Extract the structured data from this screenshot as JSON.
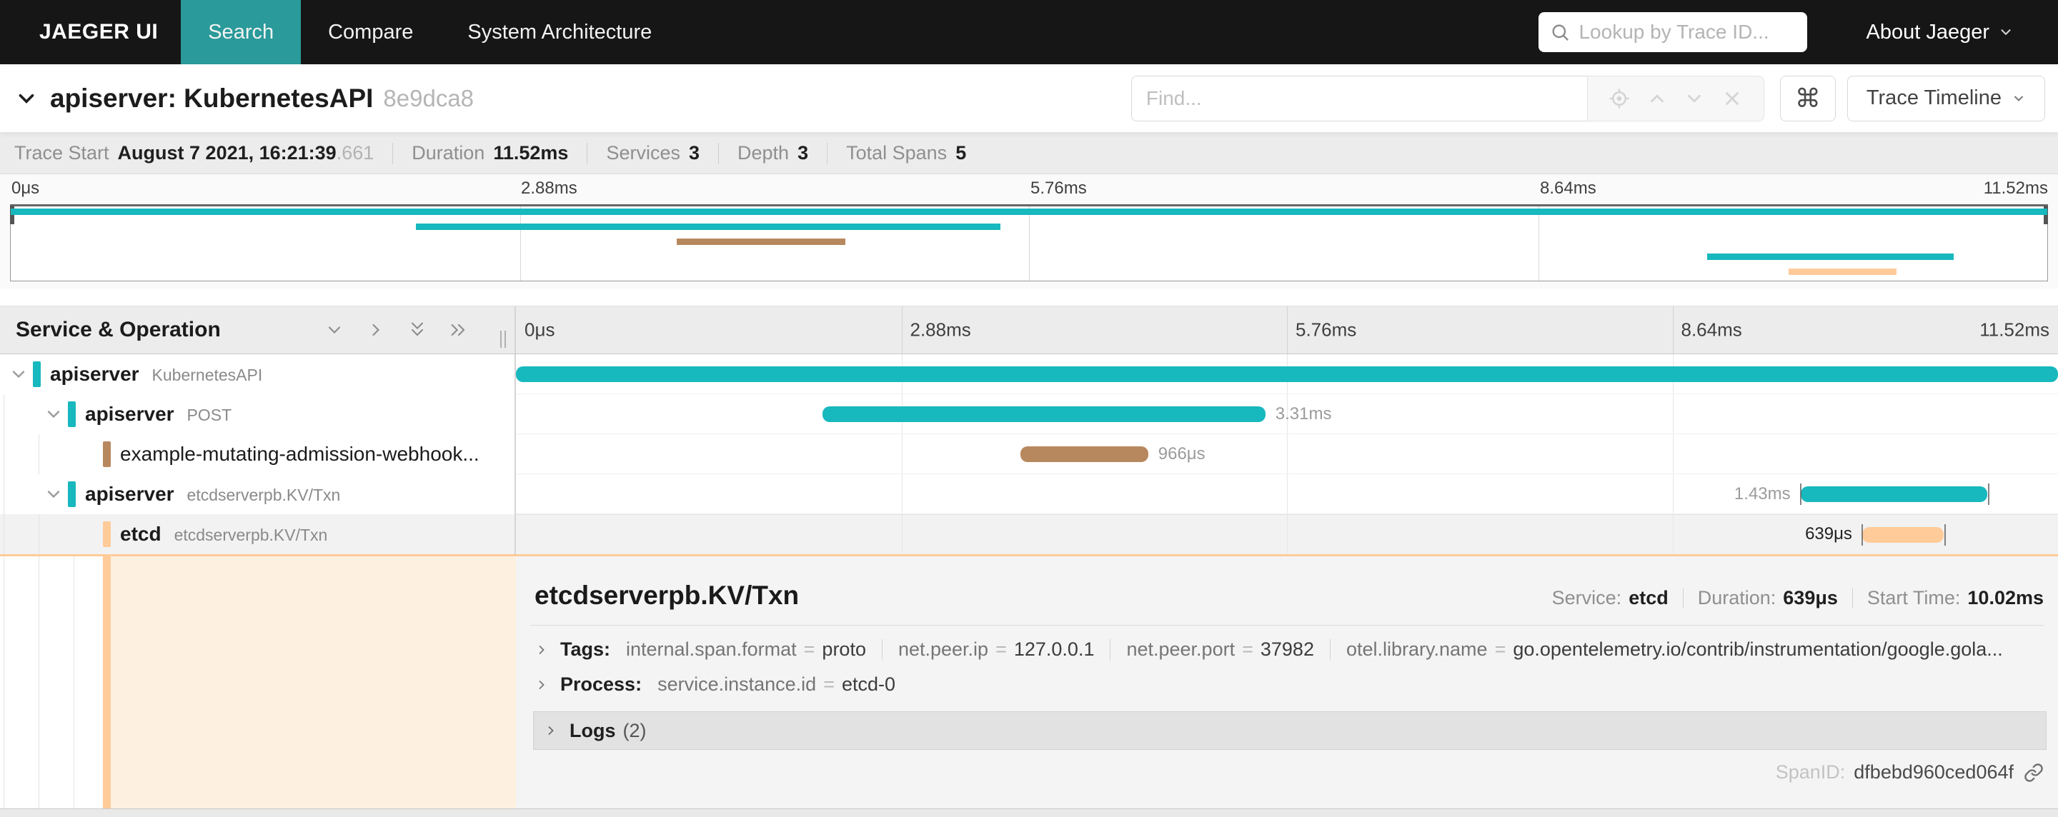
{
  "colors": {
    "nav_bg": "#161616",
    "nav_active": "#2a9a9a",
    "teal": "#17B8BE",
    "brown": "#B7885E",
    "peach": "#FFCB99",
    "selected_row_bg": "#f2f2f2",
    "panel_bg": "#f4f4f4"
  },
  "nav": {
    "brand": "JAEGER UI",
    "items": [
      {
        "label": "Search",
        "active": true
      },
      {
        "label": "Compare",
        "active": false
      },
      {
        "label": "System Architecture",
        "active": false
      }
    ],
    "lookup_placeholder": "Lookup by Trace ID...",
    "about_label": "About Jaeger"
  },
  "trace_header": {
    "title": "apiserver: KubernetesAPI",
    "trace_id": "8e9dca8",
    "find_placeholder": "Find...",
    "shortcut_key": "⌘",
    "view_label": "Trace Timeline"
  },
  "summary": {
    "items": [
      {
        "label": "Trace Start",
        "value": "August 7 2021, 16:21:39",
        "suffix": ".661"
      },
      {
        "label": "Duration",
        "value": "11.52ms",
        "suffix": ""
      },
      {
        "label": "Services",
        "value": "3",
        "suffix": ""
      },
      {
        "label": "Depth",
        "value": "3",
        "suffix": ""
      },
      {
        "label": "Total Spans",
        "value": "5",
        "suffix": ""
      }
    ]
  },
  "timeline": {
    "header_label": "Service & Operation",
    "ticks": [
      {
        "label": "0μs",
        "pos": 0
      },
      {
        "label": "2.88ms",
        "pos": 25
      },
      {
        "label": "5.76ms",
        "pos": 50
      },
      {
        "label": "8.64ms",
        "pos": 75
      },
      {
        "label": "11.52ms",
        "pos": 100
      }
    ]
  },
  "spans": [
    {
      "service": "apiserver",
      "operation": "KubernetesAPI",
      "depth": 0,
      "expandable": true,
      "color": "#17B8BE",
      "bar": {
        "start": 0,
        "width": 100
      },
      "duration_label": "",
      "label_side": "right",
      "end_ticks": false,
      "selected": false
    },
    {
      "service": "apiserver",
      "operation": "POST",
      "depth": 1,
      "expandable": true,
      "color": "#17B8BE",
      "bar": {
        "start": 19.9,
        "width": 28.7
      },
      "duration_label": "3.31ms",
      "label_side": "right",
      "end_ticks": false,
      "selected": false
    },
    {
      "service": "example-mutating-admission-webhook...",
      "operation": "",
      "depth": 2,
      "expandable": false,
      "color": "#B7885E",
      "bar": {
        "start": 32.7,
        "width": 8.3
      },
      "duration_label": "966μs",
      "label_side": "right",
      "end_ticks": false,
      "selected": false
    },
    {
      "service": "apiserver",
      "operation": "etcdserverpb.KV/Txn",
      "depth": 1,
      "expandable": true,
      "color": "#17B8BE",
      "bar": {
        "start": 83.3,
        "width": 12.1
      },
      "duration_label": "1.43ms",
      "label_side": "left",
      "end_ticks": true,
      "selected": false
    },
    {
      "service": "etcd",
      "operation": "etcdserverpb.KV/Txn",
      "depth": 2,
      "expandable": false,
      "color": "#FFCB99",
      "bar": {
        "start": 87.3,
        "width": 5.3
      },
      "duration_label": "639μs",
      "label_side": "left",
      "end_ticks": true,
      "selected": true
    }
  ],
  "detail": {
    "title": "etcdserverpb.KV/Txn",
    "meta": [
      {
        "label": "Service:",
        "value": "etcd"
      },
      {
        "label": "Duration:",
        "value": "639μs"
      },
      {
        "label": "Start Time:",
        "value": "10.02ms"
      }
    ],
    "sections": [
      {
        "label": "Tags:",
        "items": [
          {
            "key": "internal.span.format",
            "value": "proto"
          },
          {
            "key": "net.peer.ip",
            "value": "127.0.0.1"
          },
          {
            "key": "net.peer.port",
            "value": "37982"
          },
          {
            "key": "otel.library.name",
            "value": "go.opentelemetry.io/contrib/instrumentation/google.gola..."
          }
        ]
      },
      {
        "label": "Process:",
        "items": [
          {
            "key": "service.instance.id",
            "value": "etcd-0"
          }
        ]
      }
    ],
    "logs_label": "Logs",
    "logs_count": "(2)",
    "footer": {
      "label": "SpanID:",
      "value": "dfbebd960ced064f"
    }
  }
}
